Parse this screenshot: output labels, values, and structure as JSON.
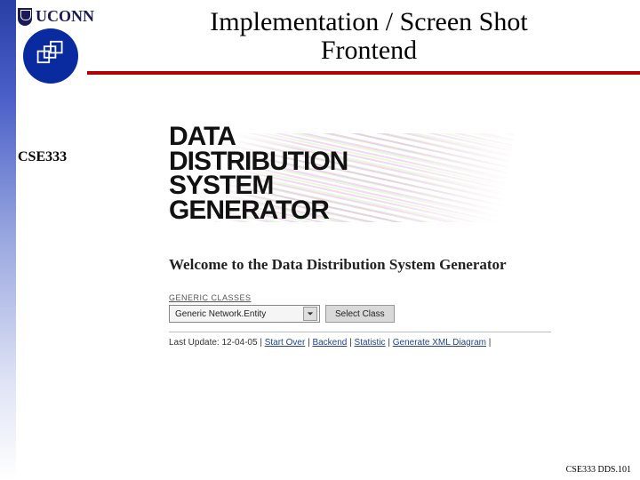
{
  "brand": {
    "uconn": "UCONN"
  },
  "title": {
    "line1": "Implementation / Screen Shot",
    "line2": "Frontend"
  },
  "course": "CSE333",
  "ddsg": {
    "w1": "DATA",
    "w2": "DISTRIBUTION",
    "w3": "SYSTEM",
    "w4": "GENERATOR"
  },
  "welcome": "Welcome to the Data Distribution System Generator",
  "section_label": "GENERIC CLASSES",
  "select": {
    "value": "Generic Network.Entity"
  },
  "buttons": {
    "select_class": "Select Class"
  },
  "footer": {
    "last_update_label": "Last Update:",
    "last_update_value": "12-04-05",
    "links": {
      "start_over": "Start Over",
      "backend": "Backend",
      "statistic": "Statistic",
      "generate_xml": "Generate XML Diagram"
    },
    "sep": " | "
  },
  "slide_number": "CSE333 DDS.101"
}
